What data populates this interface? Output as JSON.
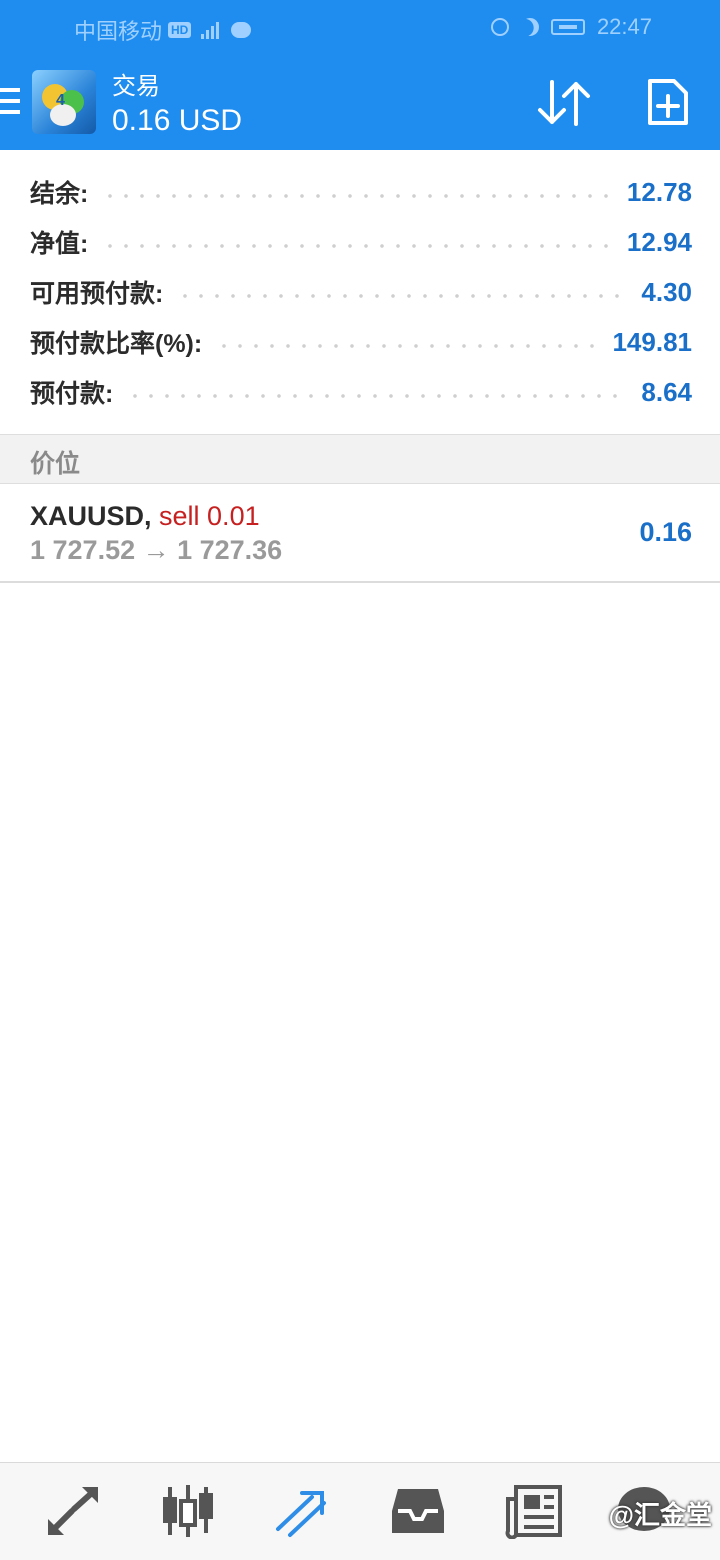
{
  "status_bar": {
    "carrier": "中国移动",
    "hd_badge": "HD",
    "time": "22:47"
  },
  "app_bar": {
    "title": "交易",
    "subtitle": "0.16 USD"
  },
  "account": [
    {
      "label": "结余:",
      "value": "12.78"
    },
    {
      "label": "净值:",
      "value": "12.94"
    },
    {
      "label": "可用预付款:",
      "value": "4.30"
    },
    {
      "label": "预付款比率(%):",
      "value": "149.81"
    },
    {
      "label": "预付款:",
      "value": "8.64"
    }
  ],
  "positions_section": {
    "header": "价位"
  },
  "positions": [
    {
      "symbol": "XAUUSD,",
      "type": "sell 0.01",
      "prices": "1 727.52 → 1 727.36",
      "profit": "0.16"
    }
  ],
  "bottom_nav": {
    "items": [
      {
        "icon": "quotes-arrows-icon",
        "active": false
      },
      {
        "icon": "chart-candles-icon",
        "active": false
      },
      {
        "icon": "trade-icon",
        "active": true
      },
      {
        "icon": "history-inbox-icon",
        "active": false
      },
      {
        "icon": "news-icon",
        "active": false
      },
      {
        "icon": "chat-icon",
        "active": false
      }
    ]
  },
  "watermark": "@汇金堂",
  "colors": {
    "app_bar": "#1f8df0",
    "value_blue": "#1a6fc9",
    "sell_red": "#c62020",
    "active_nav": "#2e8de6"
  }
}
